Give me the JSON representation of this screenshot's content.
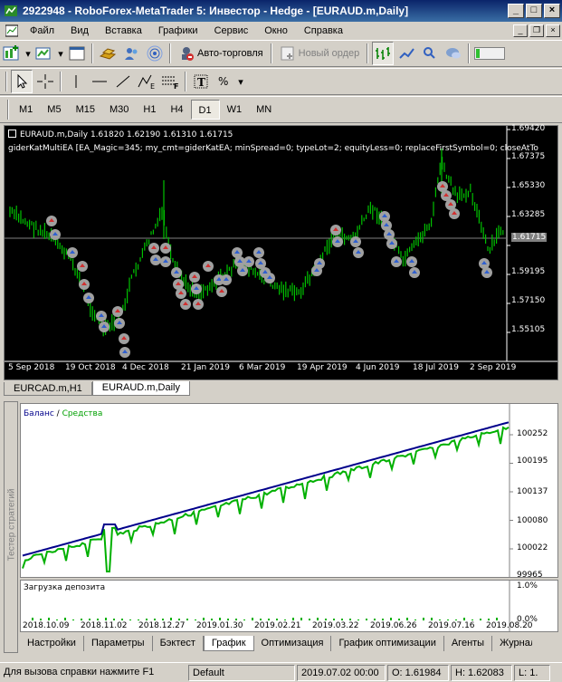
{
  "window": {
    "title": "2922948 - RoboForex-MetaTrader 5: Инвестор - Hedge - [EURAUD.m,Daily]",
    "minimize": "_",
    "maximize": "□",
    "close": "×"
  },
  "menu": [
    "Файл",
    "Вид",
    "Вставка",
    "Графики",
    "Сервис",
    "Окно",
    "Справка"
  ],
  "toolbar1": {
    "autotrading": "Авто-торговля",
    "new_order": "Новый ордер"
  },
  "timeframes": [
    "M1",
    "M5",
    "M15",
    "M30",
    "H1",
    "H4",
    "D1",
    "W1",
    "MN"
  ],
  "active_timeframe": "D1",
  "chart": {
    "header": "EURAUD.m,Daily  1.61820 1.62190 1.61310 1.61715",
    "ea_line": "giderKatMultiEA [EA_Magic=345; my_cmt=giderKatEA; minSpread=0; typeLot=2; equityLess=0; replaceFirstSymbol=0; closeAtTo",
    "price_labels": [
      "1.69420",
      "1.67375",
      "1.65330",
      "1.63285",
      "1.61715",
      "1.59195",
      "1.57150",
      "1.55105"
    ],
    "current_price": "1.61715",
    "date_labels": [
      "5 Sep 2018",
      "19 Oct 2018",
      "4 Dec 2018",
      "21 Jan 2019",
      "6 Mar 2019",
      "19 Apr 2019",
      "4 Jun 2019",
      "18 Jul 2019",
      "2 Sep 2019"
    ],
    "colors": {
      "bg": "#000000",
      "candle": "#00c000",
      "current_line": "#808080"
    }
  },
  "chart_tabs": [
    "EURCAD.m,H1",
    "EURAUD.m,Daily"
  ],
  "active_chart_tab": "EURAUD.m,Daily",
  "tester": {
    "vertical_title": "Тестер стратегий",
    "legend_balance": "Баланс",
    "legend_slash": " / ",
    "legend_equity": "Средства",
    "balance_levels": [
      "100252",
      "100195",
      "100137",
      "100080",
      "100022",
      "99965"
    ],
    "deposit_title": "Загрузка депозита",
    "deposit_levels": [
      "1.0%",
      "0.0%"
    ],
    "dates": [
      "2018.10.09",
      "2018.11.02",
      "2018.12.27",
      "2019.01.30",
      "2019.02.21",
      "2019.03.22",
      "2019.06.26",
      "2019.07.16",
      "2019.08.20"
    ],
    "colors": {
      "balance": "#00008b",
      "equity": "#00b000"
    },
    "tabs": [
      "Настройки",
      "Параметры",
      "Бэктест",
      "График",
      "Оптимизация",
      "График оптимизации",
      "Агенты",
      "Журнал"
    ],
    "active_tab": "График"
  },
  "status": {
    "help": "Для вызова справки нажмите F1",
    "profile": "Default",
    "datetime": "2019.07.02 00:00",
    "open": "O: 1.61984",
    "high": "H: 1.62083",
    "low": "L: 1."
  }
}
